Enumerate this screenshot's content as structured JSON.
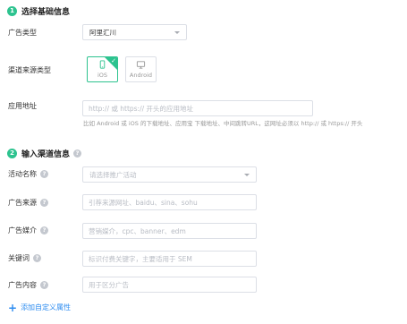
{
  "section1": {
    "step": "1",
    "title": "选择基础信息"
  },
  "ad_type": {
    "label": "广告类型",
    "value": "阿里汇川"
  },
  "channel_source_type": {
    "label": "渠道来源类型",
    "options": [
      {
        "label": "iOS",
        "selected": true,
        "icon": "phone-icon"
      },
      {
        "label": "Android",
        "selected": false,
        "icon": "monitor-icon"
      }
    ]
  },
  "app_url": {
    "label": "应用地址",
    "placeholder": "http:// 或 https:// 开头的应用地址",
    "hint": "比如 Android 或 iOS 的下载地址、应用宝 下载地址、中间跳转URL，这网址必须以 http:// 或 https:// 开头"
  },
  "section2": {
    "step": "2",
    "title": "输入渠道信息"
  },
  "activity_name": {
    "label": "活动名称",
    "placeholder": "请选择推广活动"
  },
  "ad_source": {
    "label": "广告来源",
    "placeholder": "引荐来源网址、baidu、sina、sohu"
  },
  "ad_medium": {
    "label": "广告媒介",
    "placeholder": "营销媒介，cpc、banner、edm"
  },
  "keyword": {
    "label": "关键词",
    "placeholder": "标识付费关键字，主要适用于 SEM"
  },
  "ad_content": {
    "label": "广告内容",
    "placeholder": "用于区分广告"
  },
  "add_custom_attr": {
    "label": "添加自定义属性"
  },
  "colors": {
    "accent_green": "#2dc38f",
    "link_blue": "#2d8cf0",
    "help_icon": "#c4c8cf"
  }
}
